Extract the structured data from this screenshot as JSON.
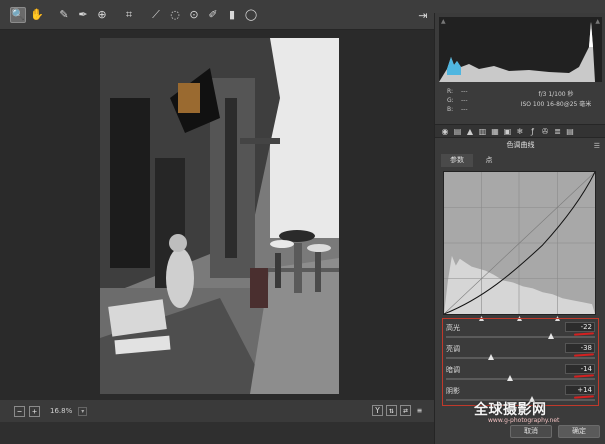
{
  "toolbar": {
    "tools": [
      {
        "name": "zoom-tool",
        "icon": "🔍",
        "active": true
      },
      {
        "name": "hand-tool",
        "icon": "✋"
      },
      {
        "name": "white-balance-tool",
        "icon": "✎"
      },
      {
        "name": "color-sampler-tool",
        "icon": "✒"
      },
      {
        "name": "targeted-adjustment-tool",
        "icon": "⊕"
      },
      {
        "name": "crop-tool",
        "icon": "⌗"
      },
      {
        "name": "straighten-tool",
        "icon": "⟋"
      },
      {
        "name": "spot-removal-tool",
        "icon": "◌"
      },
      {
        "name": "red-eye-tool",
        "icon": "⊙"
      },
      {
        "name": "adjustment-brush-tool",
        "icon": "✐"
      },
      {
        "name": "graduated-filter-tool",
        "icon": "▮"
      },
      {
        "name": "radial-filter-tool",
        "icon": "◯"
      }
    ],
    "export_icon": "⇥"
  },
  "status": {
    "zoom": "16.8%",
    "minus": "−",
    "plus": "+",
    "before_after": "Y"
  },
  "info": {
    "rgb": [
      {
        "label": "R:",
        "value": "---"
      },
      {
        "label": "G:",
        "value": "---"
      },
      {
        "label": "B:",
        "value": "---"
      }
    ],
    "camera_line1": "f/3    1/100 秒",
    "camera_line2": "ISO 100    16-80@25 毫米"
  },
  "panel": {
    "title": "色调曲线",
    "tabs": [
      "参数",
      "点"
    ],
    "sliders": [
      {
        "label": "高光",
        "value": "-22",
        "position": 0.7
      },
      {
        "label": "亮调",
        "value": "-38",
        "position": 0.31
      },
      {
        "label": "暗调",
        "value": "-14",
        "position": 0.43
      },
      {
        "label": "阴影",
        "value": "+14",
        "position": 0.57
      }
    ]
  },
  "buttons": {
    "cancel": "取消",
    "ok": "确定"
  },
  "watermark": {
    "logo": "全球摄影网",
    "url": "www.g-photography.net"
  },
  "colors": {
    "highlight_red": "#c0392b",
    "panel_bg": "#3b3b3b"
  }
}
